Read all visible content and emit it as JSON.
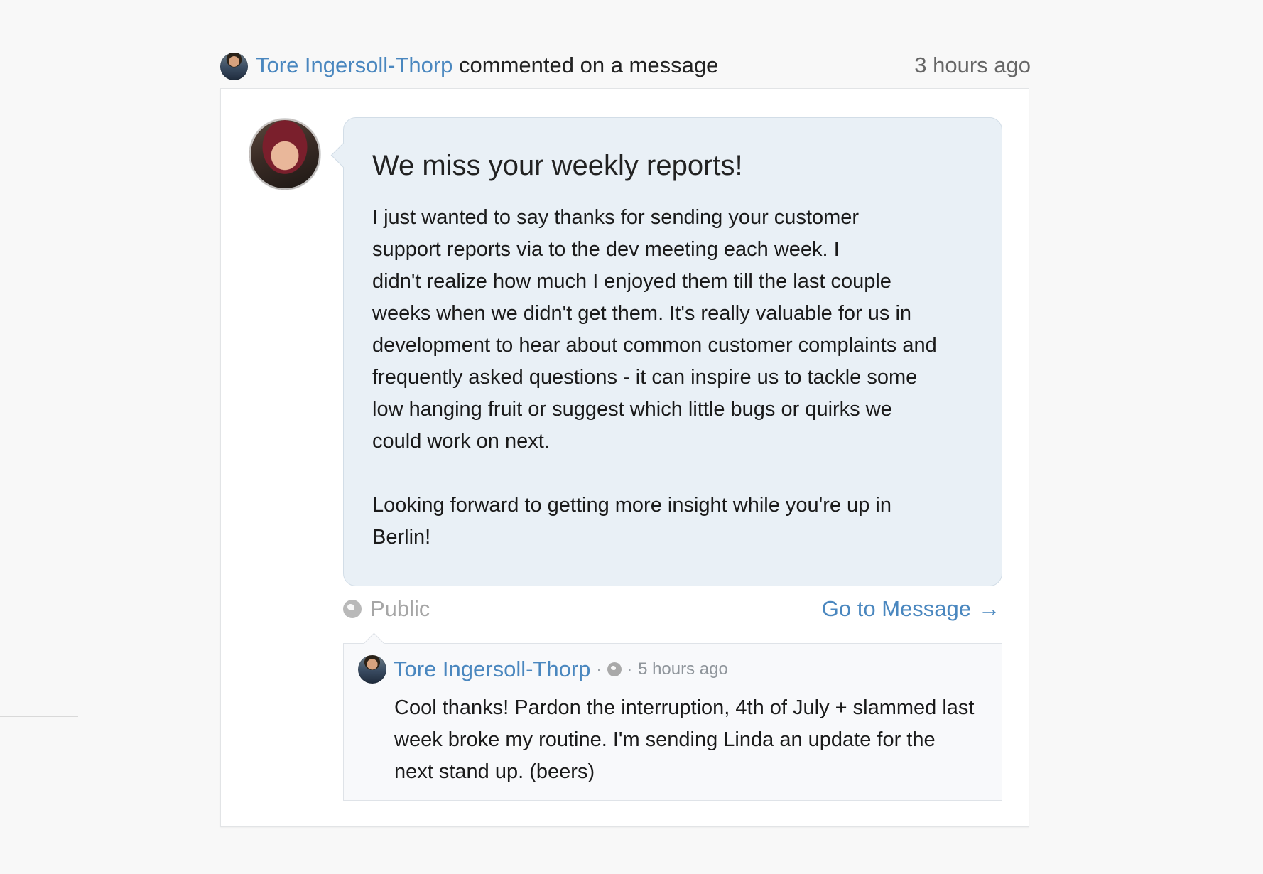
{
  "activity": {
    "author": "Tore Ingersoll-Thorp",
    "action_text": "commented on a message",
    "time": "3 hours ago"
  },
  "message": {
    "title": "We miss your weekly reports!",
    "body": "I just wanted to say thanks for sending your customer\nsupport reports via  to the dev meeting each week. I\ndidn't realize how much I enjoyed them till the last couple\nweeks when we didn't get them. It's really valuable for us in\ndevelopment to hear about common customer complaints and\nfrequently asked questions - it can inspire us to tackle some\nlow hanging fruit or suggest which little bugs or quirks we\ncould work on next.\n\nLooking forward to getting more insight while you're up in\nBerlin!",
    "visibility": "Public",
    "goto_label": "Go to Message",
    "goto_arrow": "→"
  },
  "comment": {
    "author": "Tore Ingersoll-Thorp",
    "separator": "·",
    "time": "5 hours ago",
    "body": "Cool thanks! Pardon the interruption, 4th of July + slammed last week broke my routine. I'm sending Linda an update for the next stand up. (beers)"
  },
  "icons": {
    "visibility": "globe-icon",
    "goto": "arrow-right-icon"
  },
  "colors": {
    "link": "#4a87bf",
    "bubble_background": "#e9f0f6",
    "comment_background": "#f8f9fb",
    "muted": "#a6a6a6"
  }
}
